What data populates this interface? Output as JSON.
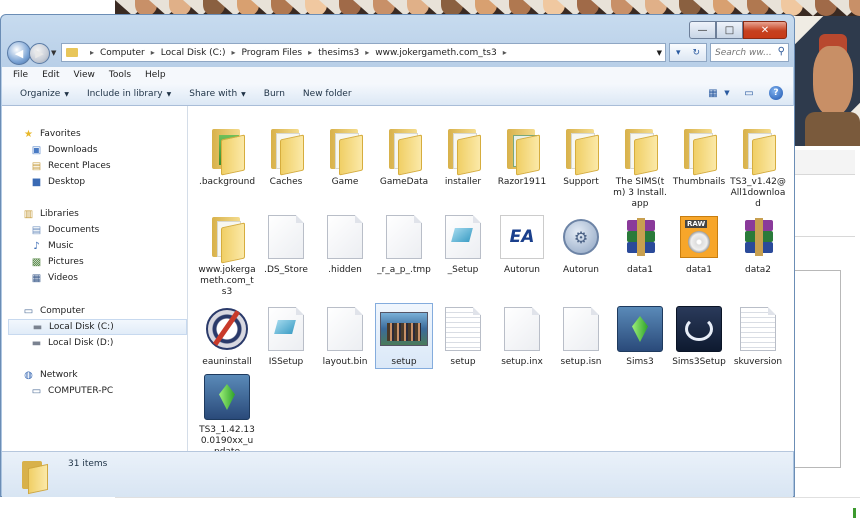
{
  "window": {
    "caption": {
      "minimize": "—",
      "maximize": "□",
      "close": "✕"
    }
  },
  "address": {
    "crumbs": [
      "Computer",
      "Local Disk (C:)",
      "Program Files",
      "thesims3",
      "www.jokergameth.com_ts3"
    ],
    "search_placeholder": "Search ww..."
  },
  "menu": [
    "File",
    "Edit",
    "View",
    "Tools",
    "Help"
  ],
  "toolbar": {
    "organize": "Organize",
    "include": "Include in library",
    "share": "Share with",
    "burn": "Burn",
    "new_folder": "New folder"
  },
  "nav": {
    "favorites": "Favorites",
    "downloads": "Downloads",
    "recent": "Recent Places",
    "desktop": "Desktop",
    "libraries": "Libraries",
    "documents": "Documents",
    "music": "Music",
    "pictures": "Pictures",
    "videos": "Videos",
    "computer": "Computer",
    "local_c": "Local Disk (C:)",
    "local_d": "Local Disk (D:)",
    "network": "Network",
    "computer_pc": "COMPUTER-PC"
  },
  "files": [
    {
      "label": ".background",
      "icon": "folder-green"
    },
    {
      "label": "Caches",
      "icon": "folder"
    },
    {
      "label": "Game",
      "icon": "folder"
    },
    {
      "label": "GameData",
      "icon": "folder"
    },
    {
      "label": "installer",
      "icon": "folder"
    },
    {
      "label": "Razor1911",
      "icon": "folder-window"
    },
    {
      "label": "Support",
      "icon": "folder"
    },
    {
      "label": "The SIMS(tm) 3 Install.app",
      "icon": "folder"
    },
    {
      "label": "Thumbnails",
      "icon": "folder"
    },
    {
      "label": "TS3_v1.42@All1download",
      "icon": "folder"
    },
    {
      "label": "www.jokergameth.com_ts3",
      "icon": "folder"
    },
    {
      "label": ".DS_Store",
      "icon": "document"
    },
    {
      "label": ".hidden",
      "icon": "document"
    },
    {
      "label": "_r_a_p_.tmp",
      "icon": "document"
    },
    {
      "label": "_Setup",
      "icon": "setup-doc"
    },
    {
      "label": "Autorun",
      "icon": "ea-logo"
    },
    {
      "label": "Autorun",
      "icon": "gear"
    },
    {
      "label": "data1",
      "icon": "winrar"
    },
    {
      "label": "data1",
      "icon": "raw-disc"
    },
    {
      "label": "data2",
      "icon": "winrar"
    },
    {
      "label": "eauninstall",
      "icon": "uninstall"
    },
    {
      "label": "ISSetup",
      "icon": "setup-doc"
    },
    {
      "label": "layout.bin",
      "icon": "document"
    },
    {
      "label": "setup",
      "icon": "sims-photo"
    },
    {
      "label": "setup",
      "icon": "document-lines"
    },
    {
      "label": "setup.inx",
      "icon": "document"
    },
    {
      "label": "setup.isn",
      "icon": "document"
    },
    {
      "label": "Sims3",
      "icon": "sims-plumbob"
    },
    {
      "label": "Sims3Setup",
      "icon": "sims3setup"
    },
    {
      "label": "skuversion",
      "icon": "document-lines"
    },
    {
      "label": "TS3_1.42.130.0190xx_update",
      "icon": "sims-plumbob"
    }
  ],
  "status": {
    "count": "31 items"
  }
}
